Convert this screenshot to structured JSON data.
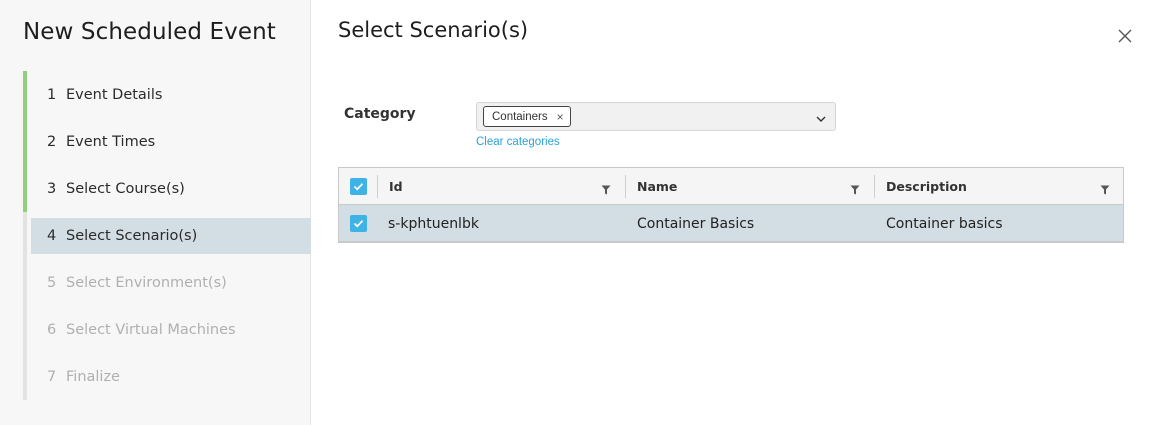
{
  "sidebar": {
    "title": "New Scheduled Event",
    "steps": [
      {
        "num": "1",
        "label": "Event Details"
      },
      {
        "num": "2",
        "label": "Event Times"
      },
      {
        "num": "3",
        "label": "Select Course(s)"
      },
      {
        "num": "4",
        "label": "Select Scenario(s)"
      },
      {
        "num": "5",
        "label": "Select Environment(s)"
      },
      {
        "num": "6",
        "label": "Select Virtual Machines"
      },
      {
        "num": "7",
        "label": "Finalize"
      }
    ]
  },
  "main": {
    "title": "Select Scenario(s)",
    "close_icon": "close-icon",
    "category": {
      "label": "Category",
      "chip": "Containers",
      "chip_remove": "×",
      "clear_link": "Clear categories"
    },
    "table": {
      "columns": [
        "Id",
        "Name",
        "Description"
      ],
      "rows": [
        {
          "id": "s-kphtuenlbk",
          "name": "Container Basics",
          "description": "Container basics",
          "selected": true
        }
      ],
      "select_all_checked": true
    }
  },
  "colors": {
    "accent": "#3fb3e6",
    "done_bar": "#8fd17b",
    "active_bg": "#d3dde4",
    "link": "#2aa3d9"
  }
}
